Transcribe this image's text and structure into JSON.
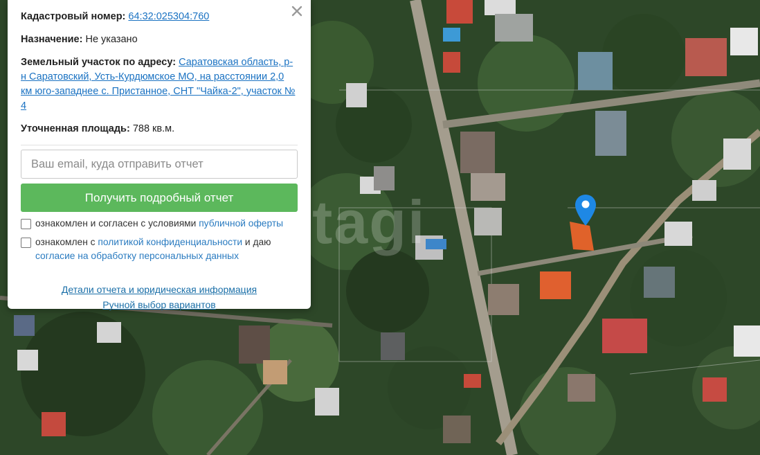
{
  "map": {
    "watermark": "etagi"
  },
  "panel": {
    "cadastral_label": "Кадастровый номер:",
    "cadastral_value": "64:32:025304:760",
    "purpose_label": "Назначение:",
    "purpose_value": "Не указано",
    "address_label": "Земельный участок по адресу:",
    "address_value": "Саратовская область, р-н Саратовский, Усть-Курдюмское МО, на расстоянии 2,0 км юго-западнее с. Пристанное, СНТ \"Чайка-2\", участок № 4",
    "area_label": "Уточненная площадь:",
    "area_value": "788 кв.м.",
    "email_placeholder": "Ваш email, куда отправить отчет",
    "submit_label": "Получить подробный отчет",
    "check1_text": "ознакомлен и согласен с условиями",
    "check1_link": "публичной оферты",
    "check2_text": "ознакомлен с",
    "check2_link1": "политикой конфиденциальности",
    "check2_mid": "и даю",
    "check2_link2": "согласие на обработку персональных данных",
    "link_details": "Детали отчета и юридическая информация",
    "link_manual": "Ручной выбор вариантов"
  },
  "colors": {
    "button": "#5cb85c",
    "link": "#1a72c2",
    "pin": "#1e88e5",
    "highlight_roof": "#e0622a"
  },
  "icons": {
    "close": "close-icon",
    "pin": "map-pin-icon"
  }
}
